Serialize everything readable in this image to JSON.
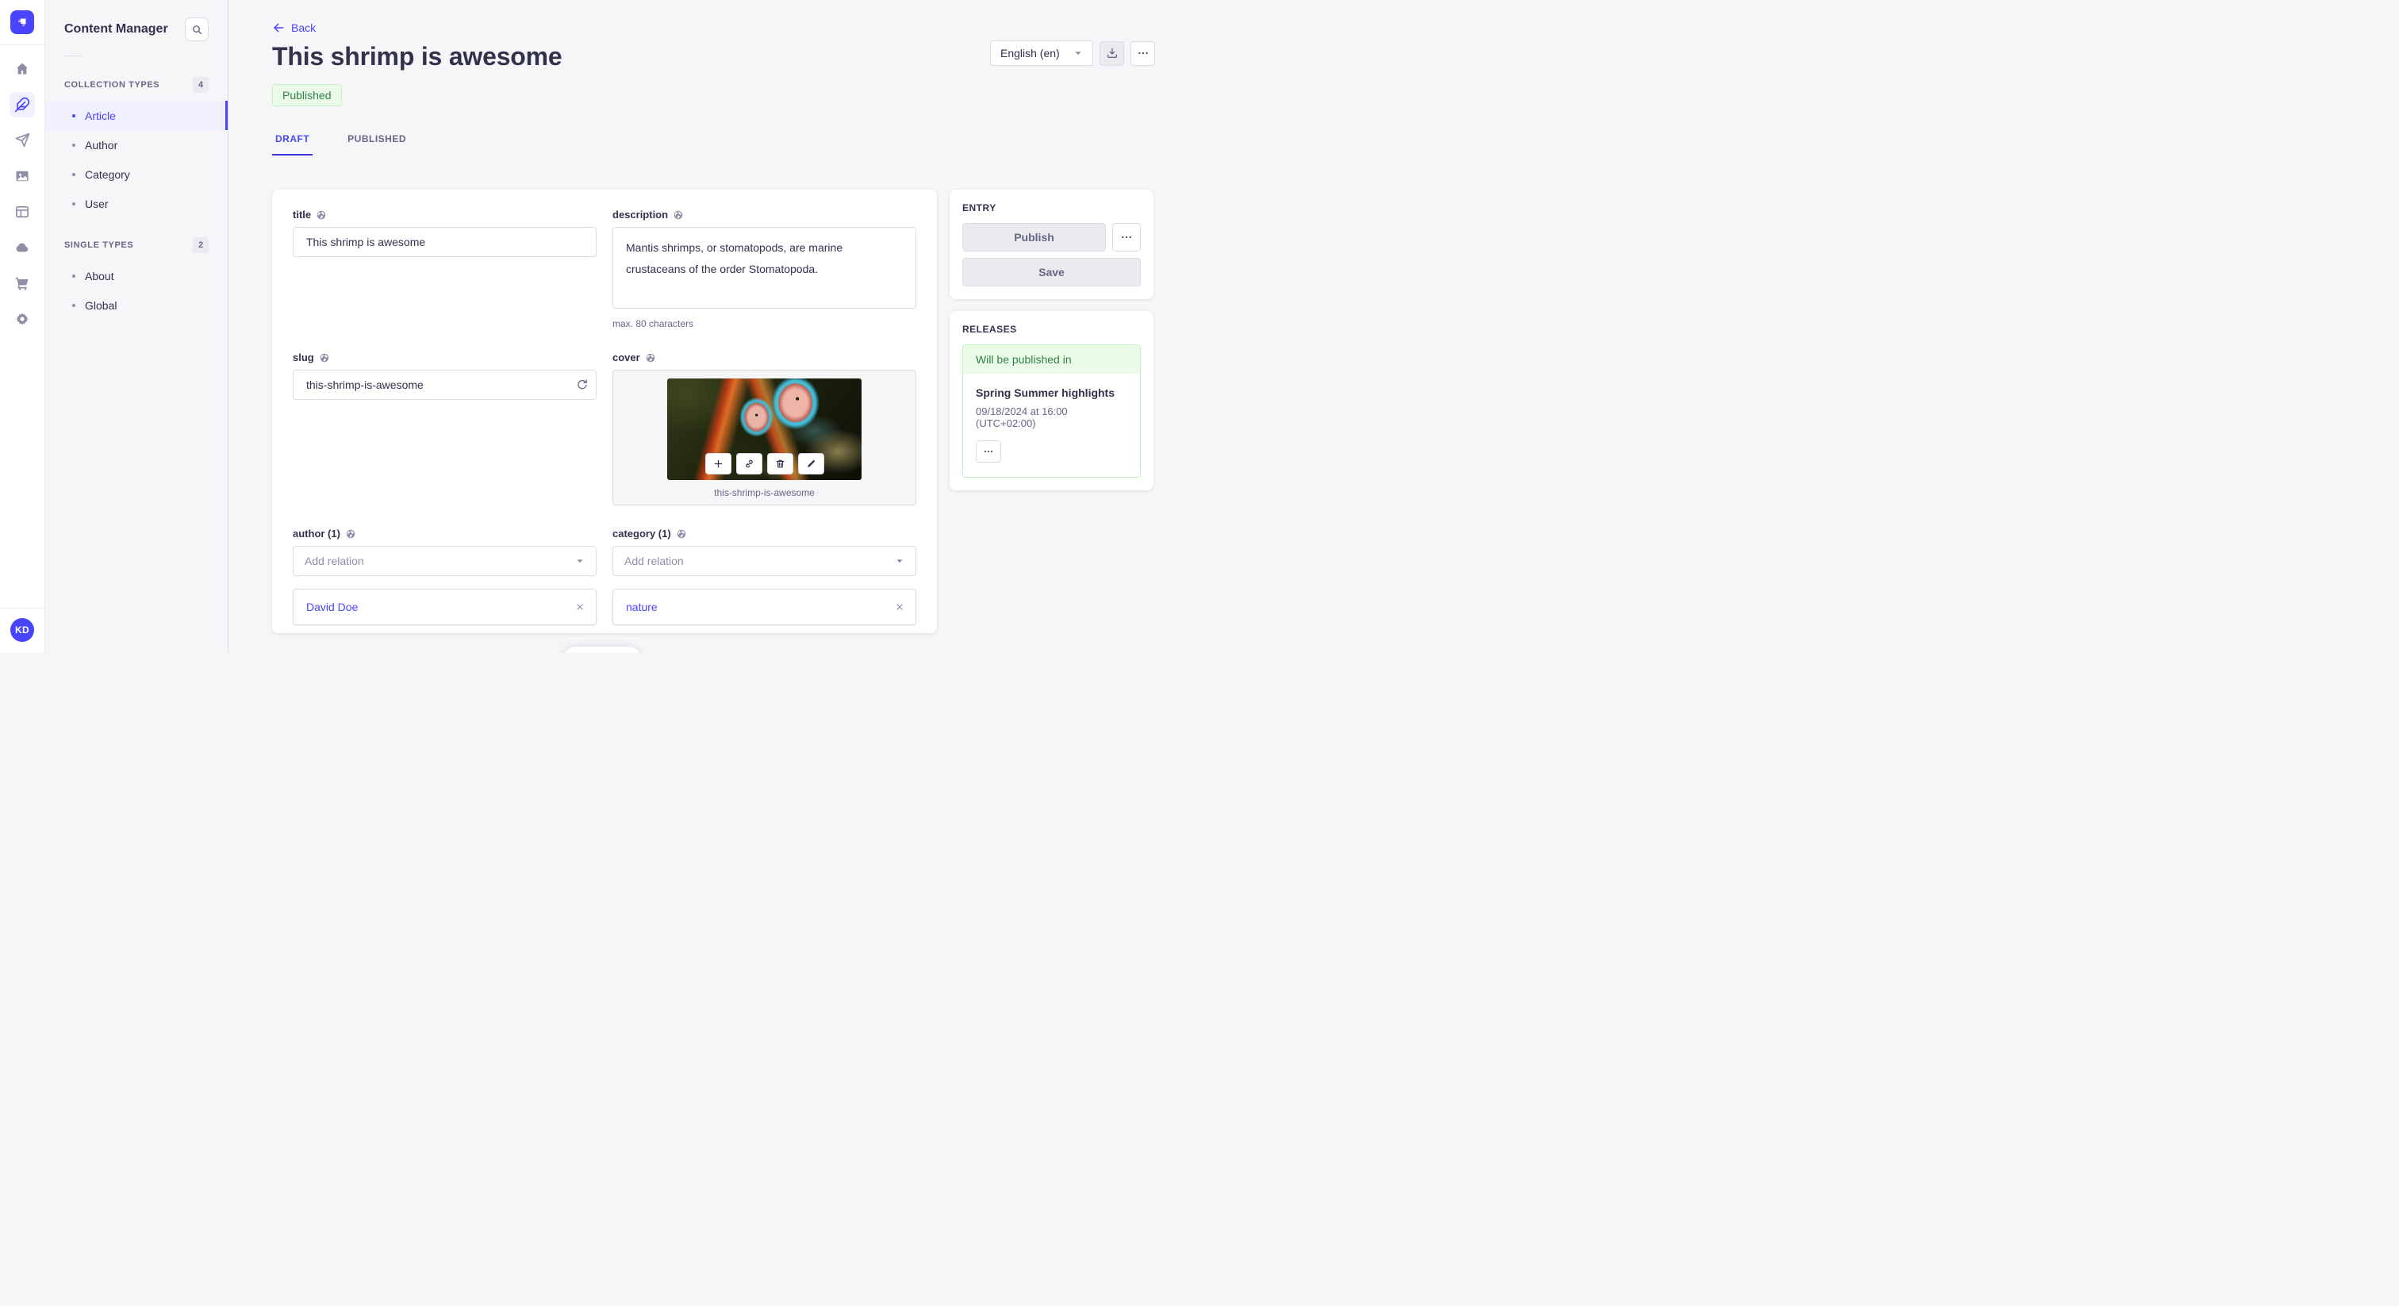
{
  "nav_rail": {
    "active": "content-manager",
    "user_initials": "KD"
  },
  "sidebar": {
    "title": "Content Manager",
    "sections": [
      {
        "label": "COLLECTION TYPES",
        "count": "4",
        "items": [
          "Article",
          "Author",
          "Category",
          "User"
        ]
      },
      {
        "label": "SINGLE TYPES",
        "count": "2",
        "items": [
          "About",
          "Global"
        ]
      }
    ],
    "active_item": "Article"
  },
  "header": {
    "back_label": "Back",
    "title": "This shrimp is awesome",
    "status_badge": "Published",
    "locale_selected": "English (en)",
    "tabs": [
      "DRAFT",
      "PUBLISHED"
    ],
    "active_tab": "DRAFT"
  },
  "form": {
    "title_field": {
      "label": "title",
      "value": "This shrimp is awesome"
    },
    "description_field": {
      "label": "description",
      "value": "Mantis shrimps, or stomatopods, are marine crustaceans of the order Stomatopoda.",
      "helper": "max. 80 characters"
    },
    "slug_field": {
      "label": "slug",
      "value": "this-shrimp-is-awesome"
    },
    "cover_field": {
      "label": "cover",
      "caption": "this-shrimp-is-awesome"
    },
    "author_field": {
      "label": "author (1)",
      "placeholder": "Add relation",
      "relations": [
        "David Doe"
      ]
    },
    "category_field": {
      "label": "category (1)",
      "placeholder": "Add relation",
      "relations": [
        "nature"
      ]
    }
  },
  "entry_panel": {
    "title": "ENTRY",
    "publish_label": "Publish",
    "save_label": "Save"
  },
  "releases_panel": {
    "title": "RELEASES",
    "status": "Will be published in",
    "release_name": "Spring Summer highlights",
    "release_date": "09/18/2024 at 16:00 (UTC+02:00)"
  },
  "colors": {
    "primary": "#4945ff",
    "primary_light": "#f0f0ff",
    "success_text": "#328048",
    "success_bg": "#eafbe7",
    "success_border": "#c6f0c2",
    "neutral_bg": "#f6f6f9",
    "border": "#dcdce4",
    "text": "#32324d",
    "text_secondary": "#666687",
    "icon": "#8e8ea9"
  }
}
